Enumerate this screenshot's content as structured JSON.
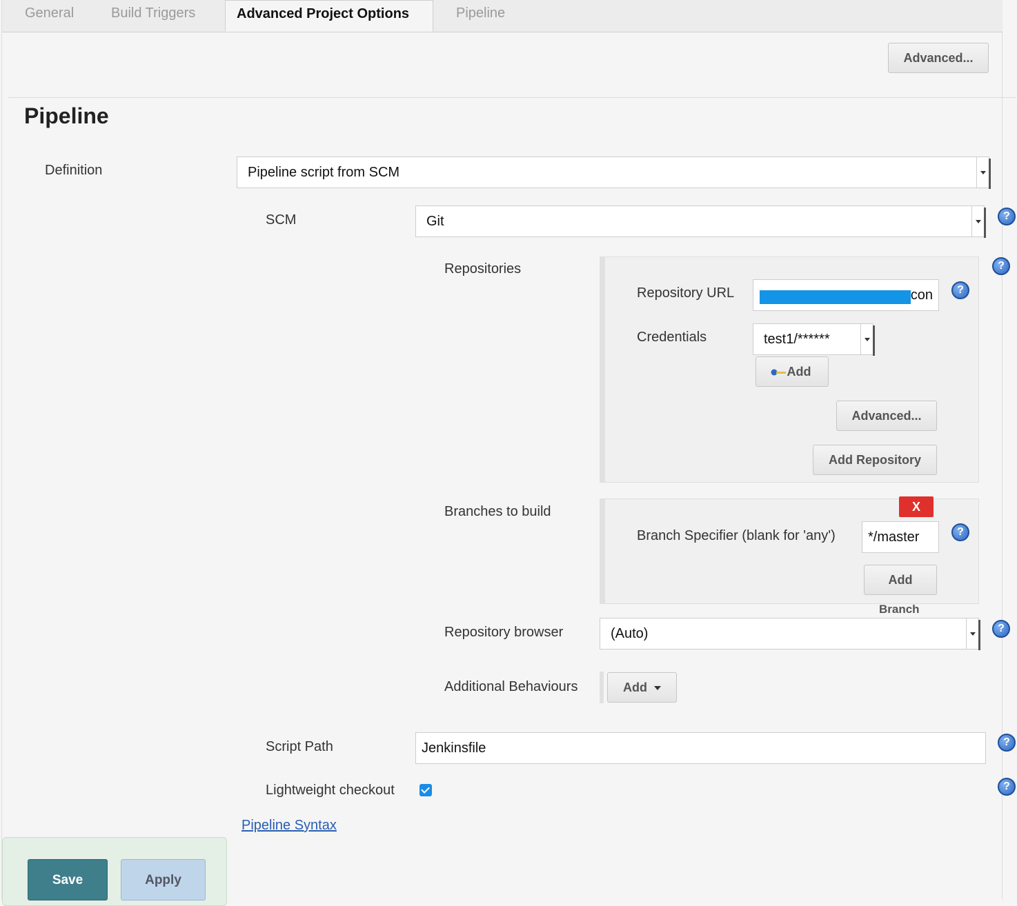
{
  "tabs": [
    {
      "label": "General"
    },
    {
      "label": "Build Triggers"
    },
    {
      "label": "Advanced Project Options"
    },
    {
      "label": "Pipeline"
    }
  ],
  "top_advanced_label": "Advanced...",
  "section_title": "Pipeline",
  "definition": {
    "label": "Definition",
    "value": "Pipeline script from SCM"
  },
  "scm": {
    "label": "SCM",
    "value": "Git"
  },
  "repositories": {
    "label": "Repositories",
    "url_label": "Repository URL",
    "url_visible_suffix": "con",
    "credentials_label": "Credentials",
    "credentials_value": "test1/******",
    "add_label": "Add",
    "advanced_label": "Advanced...",
    "add_repository_label": "Add Repository"
  },
  "branches": {
    "label": "Branches to build",
    "delete_label": "X",
    "specifier_label": "Branch Specifier (blank for 'any')",
    "specifier_value": "*/master",
    "add_label": "Add",
    "add_sub_label": "Branch"
  },
  "repo_browser": {
    "label": "Repository browser",
    "value": "(Auto)"
  },
  "additional": {
    "label": "Additional Behaviours",
    "add_label": "Add"
  },
  "script_path": {
    "label": "Script Path",
    "value": "Jenkinsfile"
  },
  "lightweight": {
    "label": "Lightweight checkout",
    "checked": true
  },
  "pipeline_syntax_label": "Pipeline Syntax",
  "footer": {
    "save_label": "Save",
    "apply_label": "Apply"
  },
  "colors": {
    "accent_blue": "#2d68c4",
    "save": "#3f7e8b",
    "apply": "#bfd6ea",
    "delete": "#e0302c",
    "redaction": "#1494e6"
  },
  "icons": {
    "help": "help-icon",
    "key": "key-icon",
    "dropdown": "chevron-down-icon",
    "check": "checkmark-icon"
  }
}
